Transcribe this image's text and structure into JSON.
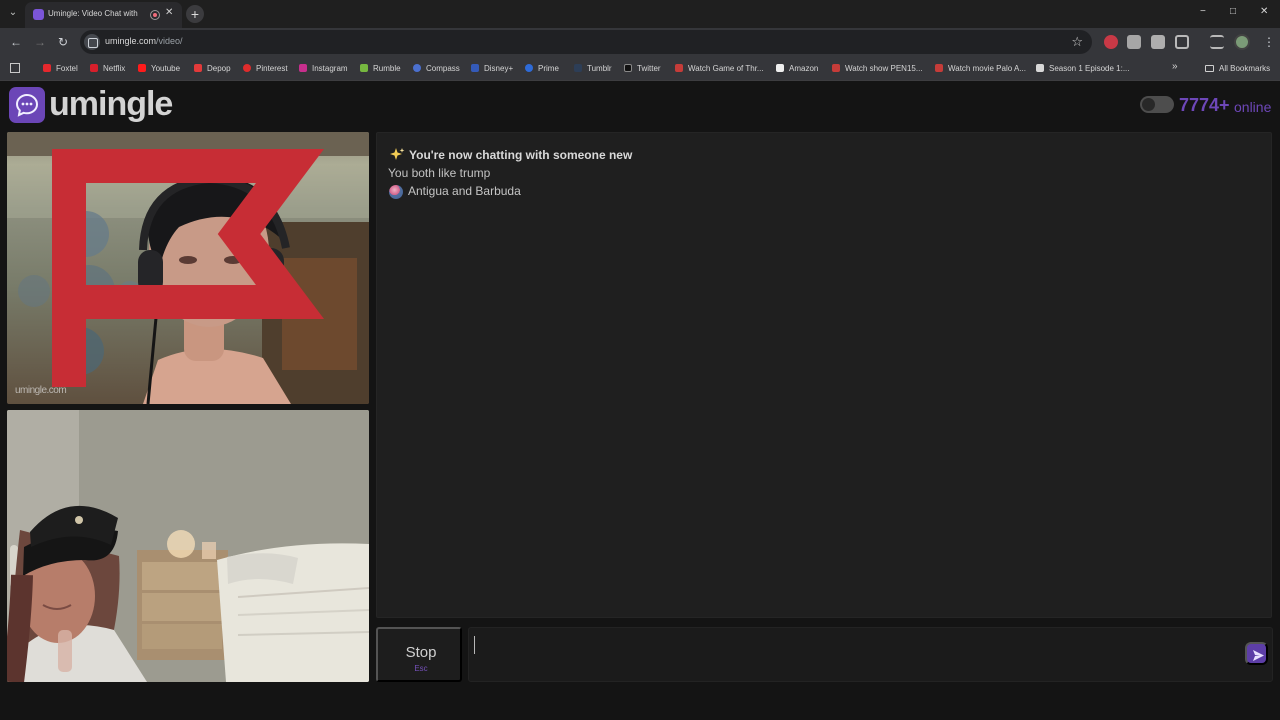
{
  "browser": {
    "tab_title": "Umingle: Video Chat with S",
    "url_domain": "umingle.com",
    "url_path": "/video/",
    "bookmarks": [
      {
        "label": "Foxtel",
        "icon": "foxtel-icon"
      },
      {
        "label": "Netflix",
        "icon": "netflix-icon"
      },
      {
        "label": "Youtube",
        "icon": "youtube-icon"
      },
      {
        "label": "Depop",
        "icon": "depop-icon"
      },
      {
        "label": "Pinterest",
        "icon": "pinterest-icon"
      },
      {
        "label": "Instagram",
        "icon": "instagram-icon"
      },
      {
        "label": "Rumble",
        "icon": "rumble-icon"
      },
      {
        "label": "Compass",
        "icon": "compass-icon"
      },
      {
        "label": "Disney+",
        "icon": "disney-icon"
      },
      {
        "label": "Prime",
        "icon": "prime-icon"
      },
      {
        "label": "Tumblr",
        "icon": "tumblr-icon"
      },
      {
        "label": "Twitter",
        "icon": "x-icon"
      },
      {
        "label": "Watch Game of Thr...",
        "icon": "video-site-icon"
      },
      {
        "label": "Amazon",
        "icon": "amazon-icon"
      },
      {
        "label": "Watch show PEN15...",
        "icon": "video-site-icon"
      },
      {
        "label": "Watch movie Palo A...",
        "icon": "video-site-icon"
      },
      {
        "label": "Season 1 Episode 1:...",
        "icon": "document-icon"
      }
    ],
    "all_bookmarks": "All Bookmarks"
  },
  "app": {
    "logo": "umingle",
    "online": {
      "count": "7774+",
      "label": "online"
    },
    "accent_color": "#6b46b7",
    "videos": {
      "remote_watermark": "umingle",
      "remote_watermark_suffix": ".com"
    },
    "chat": {
      "status_icon": "sparkles-icon",
      "status": "You're now chatting with someone new",
      "common_interest": "You both like trump",
      "country_icon": "globe-icon",
      "country": "Antigua and Barbuda"
    },
    "controls": {
      "stop_label": "Stop",
      "stop_key": "Esc",
      "message_value": "",
      "send_icon": "send-icon"
    }
  }
}
